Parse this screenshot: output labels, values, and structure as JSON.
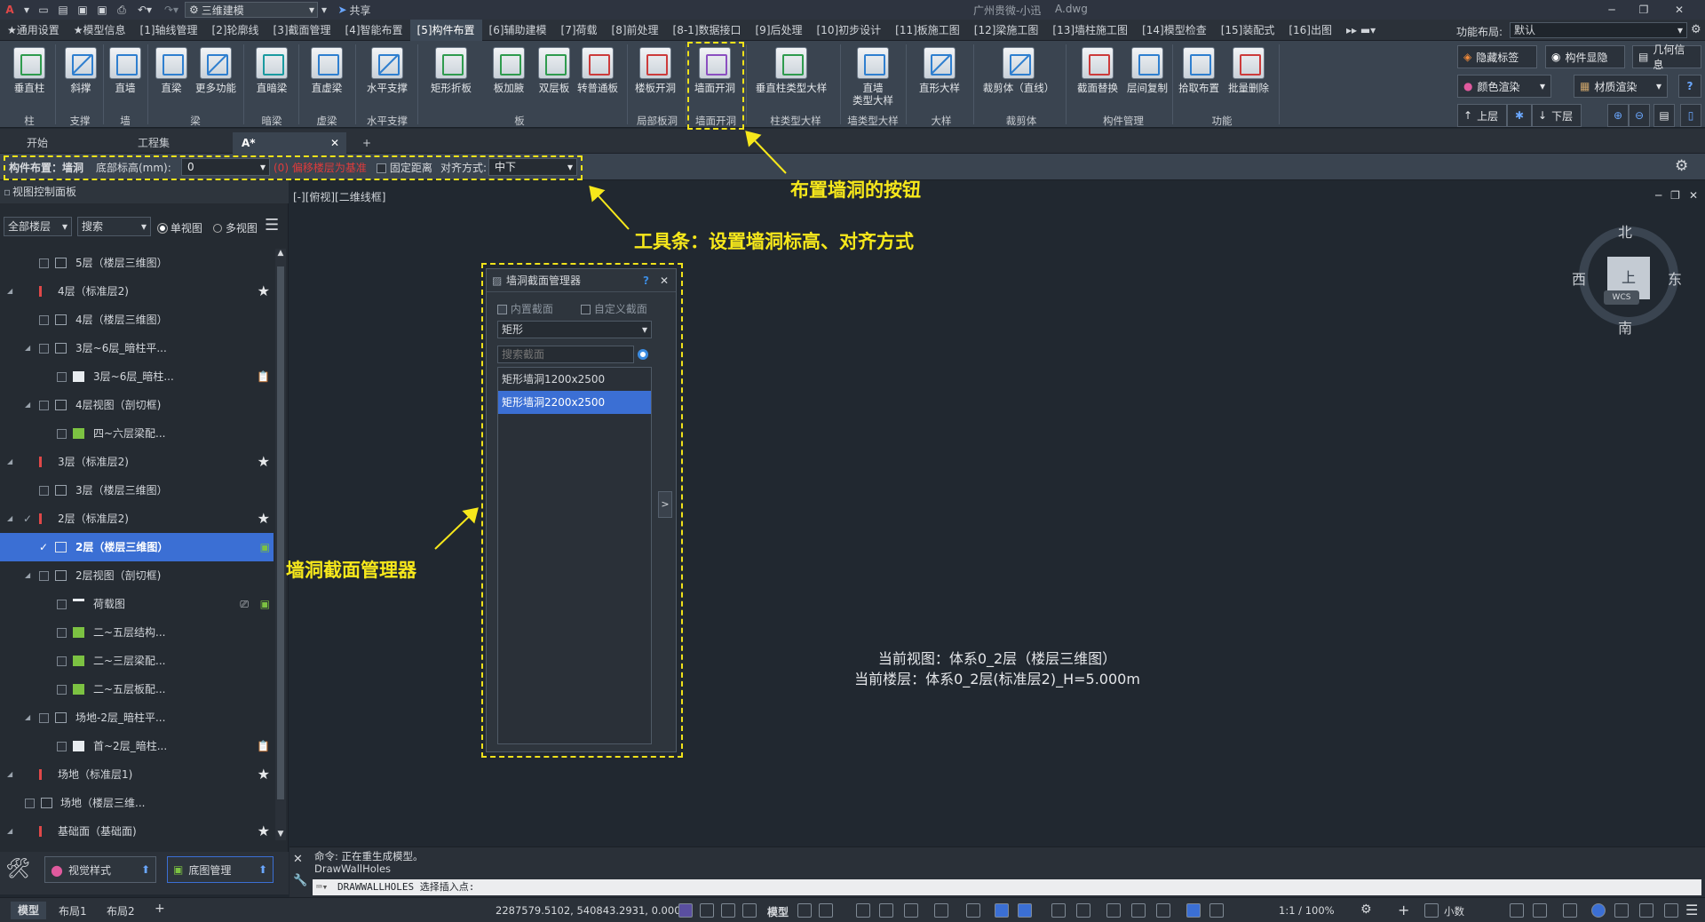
{
  "titlebar": {
    "workspace": "三维建模",
    "share": "共享",
    "user": "广州贵微-小迅",
    "filename": "A.dwg"
  },
  "menu": [
    "★通用设置",
    "★模型信息",
    "[1]轴线管理",
    "[2]轮廓线",
    "[3]截面管理",
    "[4]智能布置",
    "[5]构件布置",
    "[6]辅助建模",
    "[7]荷载",
    "[8]前处理",
    "[8-1]数据接口",
    "[9]后处理",
    "[10]初步设计",
    "[11]板施工图",
    "[12]梁施工图",
    "[13]墙柱施工图",
    "[14]模型检查",
    "[15]装配式",
    "[16]出图"
  ],
  "layout": {
    "label": "功能布局:",
    "value": "默认"
  },
  "ribbon": {
    "buttons": [
      "垂直柱",
      "斜撑",
      "直墙",
      "直梁",
      "更多功能",
      "直暗梁",
      "直虚梁",
      "水平支撑",
      "矩形折板",
      "板加腋",
      "双层板",
      "转普通板",
      "楼板开洞",
      "墙面开洞",
      "垂直柱类型大样",
      "直墙\n类型大样",
      "直形大样",
      "裁剪体（直线）",
      "截面替换",
      "层间复制",
      "拾取布置",
      "批量删除"
    ],
    "groups": [
      "柱",
      "支撑",
      "墙",
      "梁",
      "暗梁",
      "虚梁",
      "水平支撑",
      "板",
      "局部板洞",
      "墙面开洞",
      "柱类型大样",
      "墙类型大样",
      "大样",
      "裁剪体",
      "构件管理",
      "功能"
    ],
    "right": [
      "隐藏标签",
      "构件显隐",
      "几何信息",
      "颜色渲染",
      "材质渲染",
      "上层",
      "下层"
    ]
  },
  "doctabs": [
    "开始",
    "工程集",
    "A*"
  ],
  "toolbar": {
    "title": "构件布置：墙洞",
    "elev_label": "底部标高(mm):",
    "elev_value": "0",
    "warn": "(0) 偏移楼层为基准",
    "fixed_label": "固定距离",
    "align_label": "对齐方式:",
    "align_value": "中下"
  },
  "leftpanel": {
    "title": "视图控制面板",
    "floor_select": "全部楼层",
    "search": "搜索",
    "single_view": "单视图",
    "multi_view": "多视图",
    "tree": [
      {
        "label": "5层（楼层三维图）"
      },
      {
        "label": "4层（标准层2)"
      },
      {
        "label": "4层（楼层三维图）"
      },
      {
        "label": "3层~6层_暗柱平..."
      },
      {
        "label": "3层~6层_暗柱..."
      },
      {
        "label": "4层视图（剖切框)"
      },
      {
        "label": "四~六层梁配..."
      },
      {
        "label": "3层（标准层2)"
      },
      {
        "label": "3层（楼层三维图）"
      },
      {
        "label": "2层（标准层2)"
      },
      {
        "label": "2层（楼层三维图）"
      },
      {
        "label": "2层视图（剖切框)"
      },
      {
        "label": "荷载图"
      },
      {
        "label": "二~五层结构..."
      },
      {
        "label": "二~三层梁配..."
      },
      {
        "label": "二~五层板配..."
      },
      {
        "label": "场地-2层_暗柱平..."
      },
      {
        "label": "首~2层_暗柱..."
      },
      {
        "label": "场地（标准层1)"
      },
      {
        "label": "场地（楼层三维..."
      },
      {
        "label": "基础面（基础面)"
      }
    ],
    "btn_style": "视觉样式",
    "btn_base": "底图管理"
  },
  "canvas": {
    "viewlabel": "[-][俯视][二维线框]",
    "compass": {
      "n": "北",
      "s": "南",
      "e": "东",
      "w": "西",
      "top": "上",
      "wcs": "WCS"
    },
    "info1": "当前视图：体系0_2层（楼层三维图）",
    "info2": "当前楼层：体系0_2层(标准层2)_H=5.000m"
  },
  "dialog": {
    "title": "墙洞截面管理器",
    "help": "?",
    "builtin": "内置截面",
    "custom": "自定义截面",
    "shape": "矩形",
    "search_placeholder": "搜索截面",
    "items": [
      "矩形墙洞1200x2500",
      "矩形墙洞2200x2500"
    ]
  },
  "annotations": {
    "button": "布置墙洞的按钮",
    "toolbar": "工具条：设置墙洞标高、对齐方式",
    "dialog": "墙洞截面管理器"
  },
  "command": {
    "line1": "命令: 正在重生成模型。",
    "line2": "DrawWallHoles",
    "prompt": "DRAWWALLHOLES 选择插入点:"
  },
  "status": {
    "tabs": [
      "模型",
      "布局1",
      "布局2"
    ],
    "coords": "2287579.5102, 540843.2931, 0.0000",
    "mode": "模型",
    "scale": "1:1 / 100%",
    "decimal": "小数"
  }
}
